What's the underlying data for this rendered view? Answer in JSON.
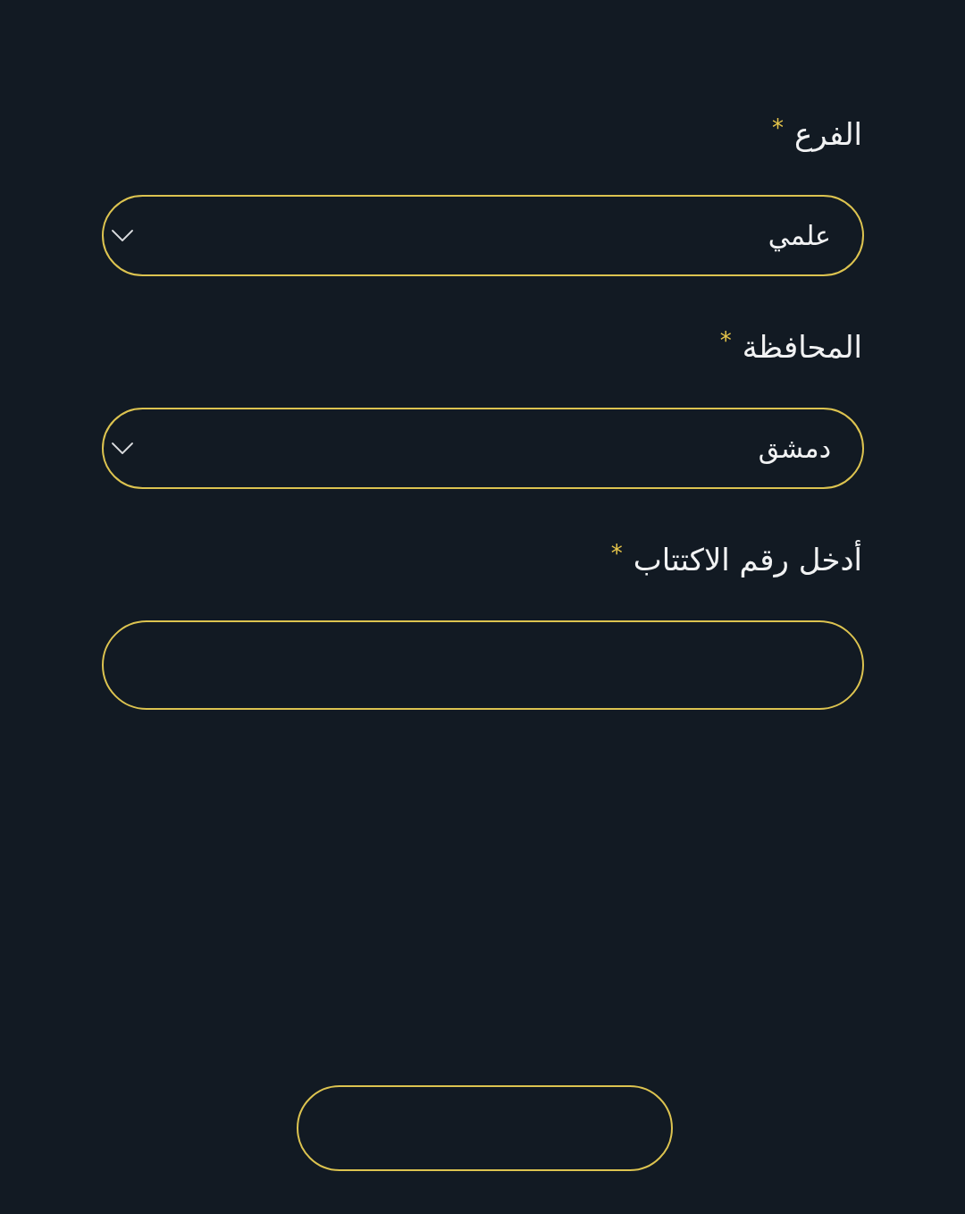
{
  "form": {
    "fields": [
      {
        "kind": "select",
        "label": "الفرع",
        "required_mark": "*",
        "value": "علمي"
      },
      {
        "kind": "select",
        "label": "المحافظة",
        "required_mark": "*",
        "value": "دمشق"
      },
      {
        "kind": "input",
        "label": "أدخل رقم الاكتتاب",
        "required_mark": "*"
      }
    ],
    "button": {
      "kind": "outlined"
    }
  }
}
